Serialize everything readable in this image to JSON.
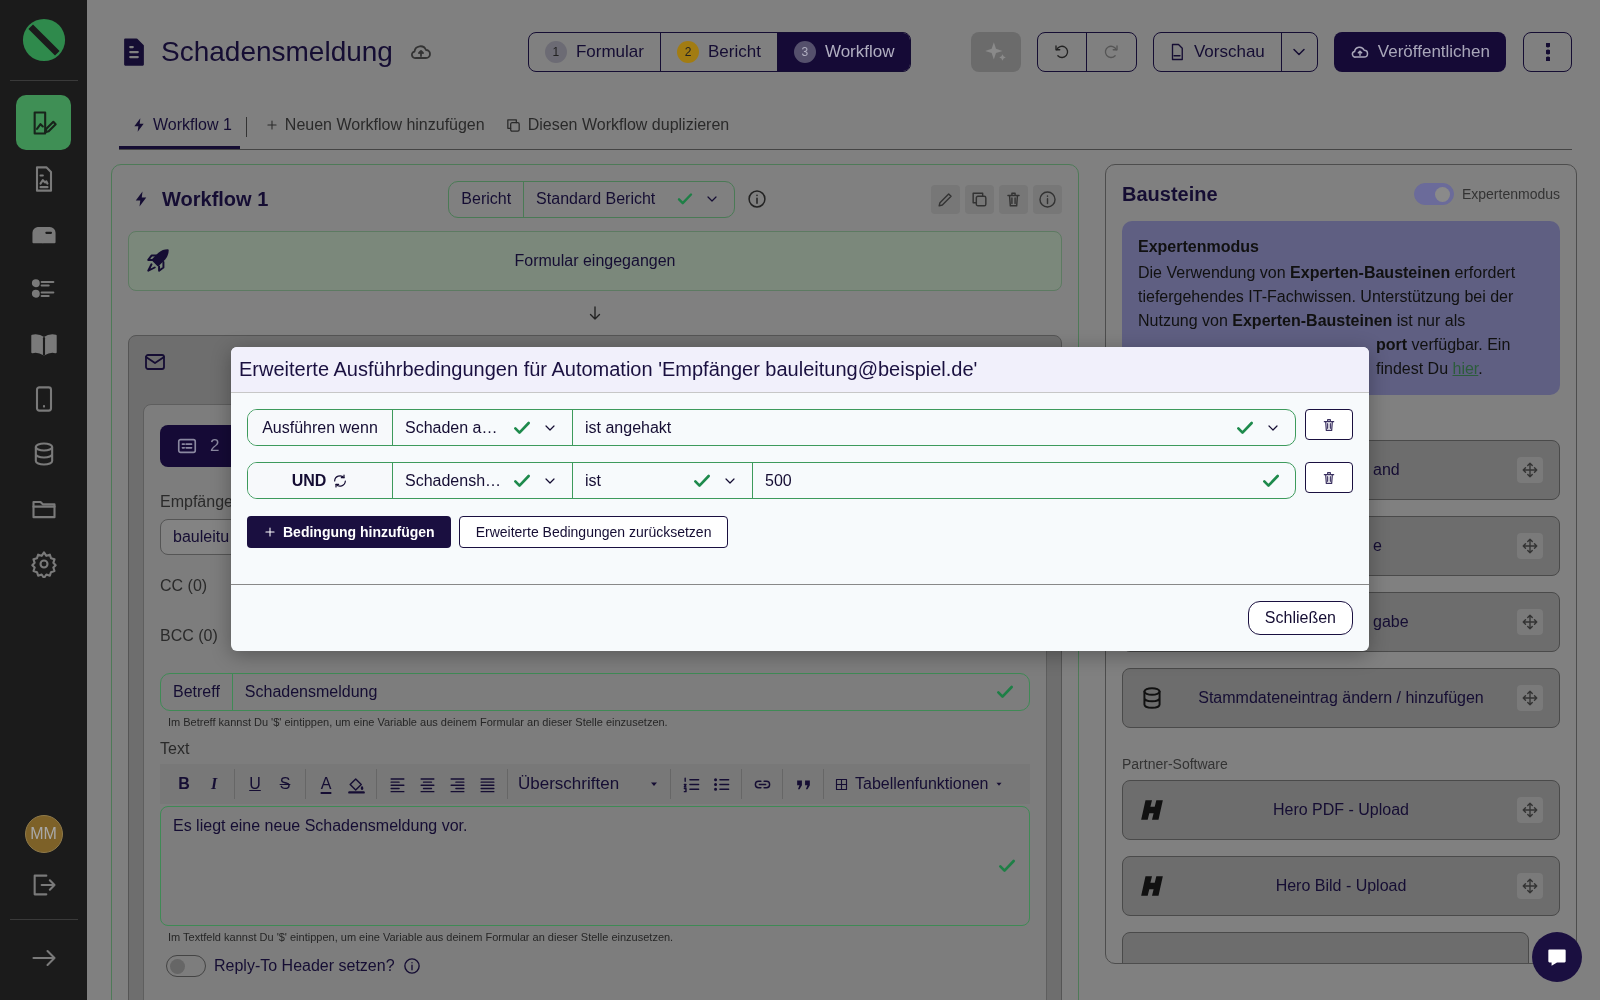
{
  "sidebar": {
    "nav": [
      {
        "selected": true
      },
      {
        "selected": false
      },
      {
        "selected": false
      },
      {
        "selected": false
      },
      {
        "selected": false
      },
      {
        "selected": false
      },
      {
        "selected": false
      },
      {
        "selected": false
      },
      {
        "selected": false
      }
    ],
    "avatar": "MM"
  },
  "header": {
    "title": "Schadensmeldung",
    "steps": [
      {
        "number": "1",
        "label": "Formular",
        "selected": false,
        "color": "#6c6b74"
      },
      {
        "number": "2",
        "label": "Bericht",
        "selected": false,
        "color": "#a27c12"
      },
      {
        "number": "3",
        "label": "Workflow",
        "selected": true,
        "color": "#55506c"
      }
    ],
    "preview": "Vorschau",
    "publish": "Veröffentlichen"
  },
  "workflow_tabs": [
    {
      "kind": "workflow",
      "label": "Workflow 1",
      "selected": true
    },
    {
      "kind": "add",
      "label": "Neuen Workflow hinzufügen",
      "selected": false
    },
    {
      "kind": "duplicate",
      "label": "Diesen Workflow duplizieren",
      "selected": false
    }
  ],
  "workflow": {
    "title": "Workflow 1",
    "report_label": "Bericht",
    "report_value": "Standard Bericht",
    "report_valid": true,
    "trigger": "Formular eingegangen",
    "action": {
      "button": "2",
      "recipient_label": "Empfänge",
      "recipient_value": "bauleitu",
      "cc": "CC (0)",
      "bcc": "BCC (0)",
      "subject_label": "Betreff",
      "subject_value": "Schadensmeldung",
      "subject_valid": true,
      "subject_hint": "Im Betreff kannst Du '$' eintippen, um eine Variable aus deinem Formular an dieser Stelle einzusetzen.",
      "text_label": "Text",
      "toolbar": {
        "glyphs": [
          "B",
          "I",
          "U",
          "S",
          "A"
        ],
        "heading_menu": "Überschriften",
        "table_menu": "Tabellenfunktionen"
      },
      "body": "Es liegt eine neue Schadensmeldung vor.",
      "body_valid": true,
      "body_hint": "Im Textfeld kannst Du '$' eintippen, um eine Variable aus deinem Formular an dieser Stelle einzusetzen.",
      "reply_to": {
        "label": "Reply-To Header setzen?",
        "on": false
      }
    }
  },
  "blocks": {
    "title": "Bausteine",
    "expert_toggle": {
      "label": "Expertenmodus",
      "on": true
    },
    "notice": {
      "title": "Expertenmodus",
      "text": "Die Verwendung von **Experten-Bausteinen** erfordert tiefergehendes IT-Fachwissen. Unterstützung bei der Nutzung von **Experten-Bausteinen** ist nur als",
      "line_4": "**port** verfügbar. Ein",
      "line_5": {
        "before": "findest Du ",
        "link": "hier",
        "after": "."
      }
    },
    "items": [
      {
        "kind": "fragment",
        "label": "and"
      },
      {
        "kind": "fragment",
        "label": "e"
      },
      {
        "kind": "fragment",
        "label": "gabe"
      },
      {
        "kind": "database",
        "label": "Stammdateneintrag ändern / hinzufügen"
      }
    ],
    "partner_label": "Partner-Software",
    "partners": [
      {
        "label": "Hero PDF - Upload"
      },
      {
        "label": "Hero Bild - Upload"
      }
    ]
  },
  "modal": {
    "title": "Erweiterte Ausführbedingungen für Automation 'Empfänger bauleitung@beispiel.de'",
    "conditions": [
      {
        "kind": "first",
        "label": "Ausführen wenn",
        "fields": [
          {
            "value": "Schaden a…",
            "valid": true,
            "dropdown": true
          },
          {
            "value": "ist angehakt",
            "valid": true,
            "dropdown": true
          }
        ]
      },
      {
        "kind": "and",
        "label": "UND",
        "fields": [
          {
            "value": "Schadensh…",
            "valid": true,
            "dropdown": true
          },
          {
            "value": "ist",
            "valid": true,
            "dropdown": true
          },
          {
            "value": "500",
            "valid": true,
            "dropdown": false
          }
        ]
      }
    ],
    "add_button": "Bedingung hinzufügen",
    "reset_button": "Erweiterte Bedingungen zurücksetzen",
    "close_button": "Schließen"
  }
}
